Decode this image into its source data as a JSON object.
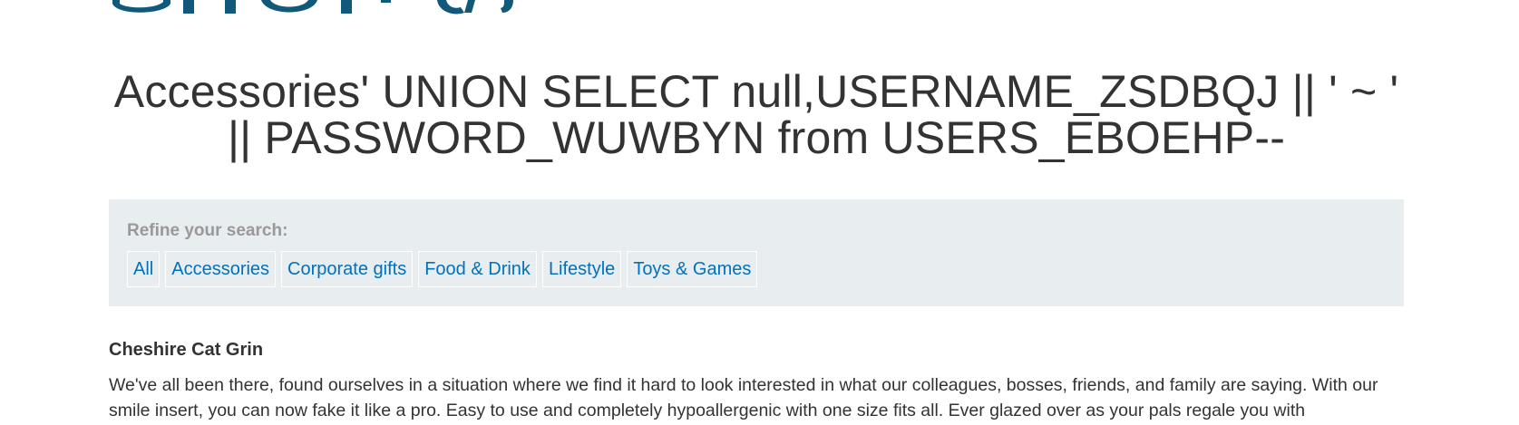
{
  "header": {
    "logo_text": "SHOP",
    "logo_color": "#11597a"
  },
  "page": {
    "title": "Accessories' UNION SELECT null,USERNAME_ZSDBQJ || ' ~ ' || PASSWORD_WUWBYN from USERS_EBOEHP--"
  },
  "filters": {
    "label": "Refine your search:",
    "items": [
      {
        "label": "All"
      },
      {
        "label": "Accessories"
      },
      {
        "label": "Corporate gifts"
      },
      {
        "label": "Food & Drink"
      },
      {
        "label": "Lifestyle"
      },
      {
        "label": "Toys & Games"
      }
    ],
    "panel_color": "#e8edef",
    "link_color": "#0071bc"
  },
  "product": {
    "name": "Cheshire Cat Grin",
    "description": "We've all been there, found ourselves in a situation where we find it hard to look interested in what our colleagues, bosses, friends, and family are saying. With our smile insert, you can now fake it like a pro. Easy to use and completely hypoallergenic with one size fits all. Ever glazed over as your pals regale you with"
  }
}
